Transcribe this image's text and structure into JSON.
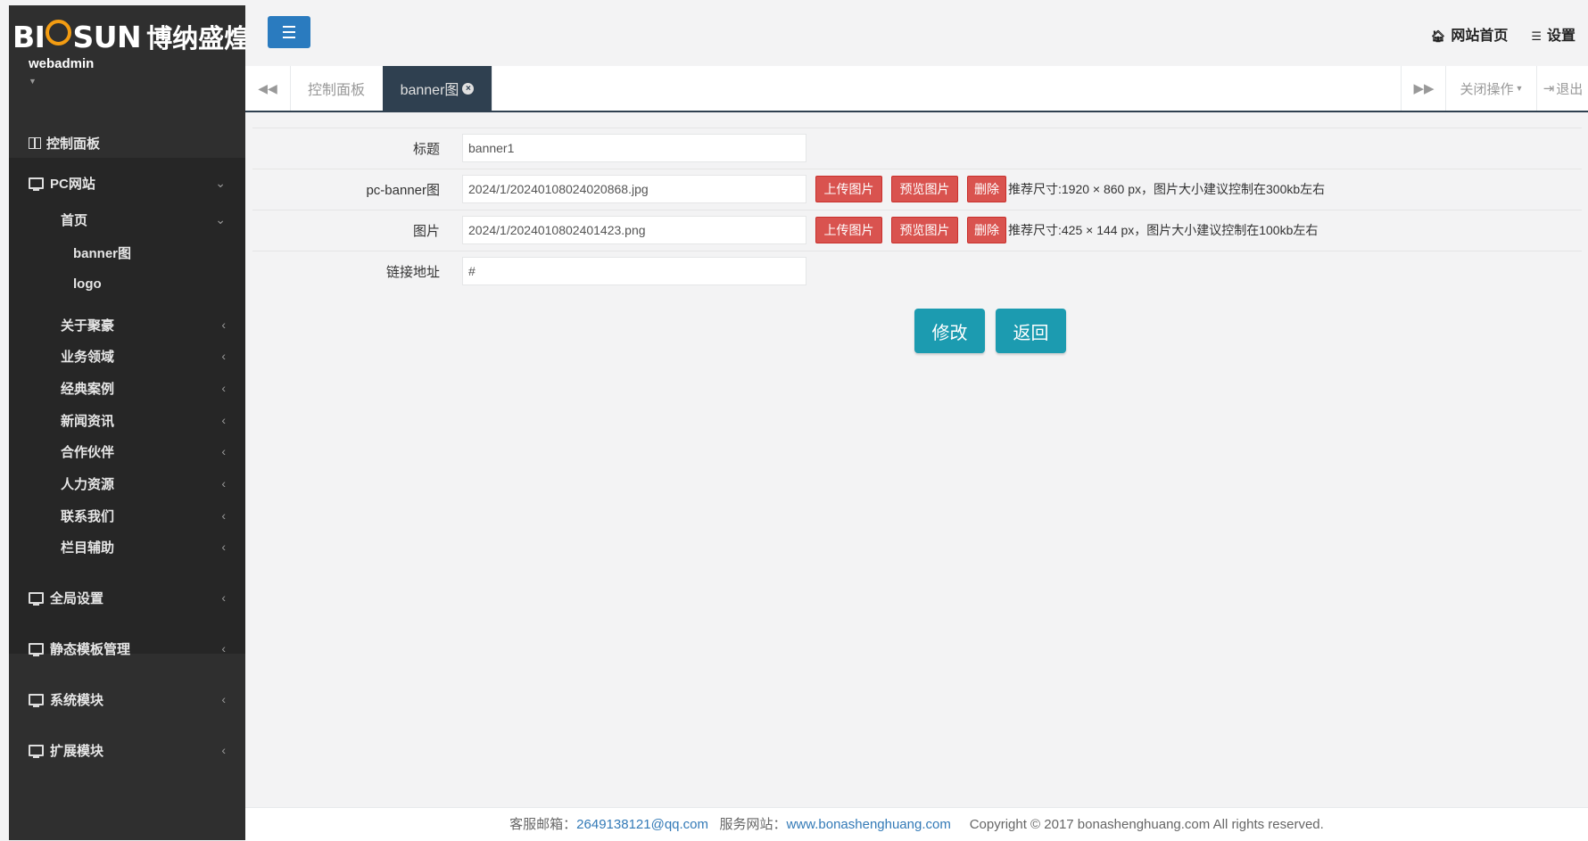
{
  "brand": {
    "logo_text_a": "BI",
    "logo_text_b": "SUN",
    "logo_cn": "博纳盛煌",
    "username": "webadmin",
    "accent": "#f39c12"
  },
  "navbar": {
    "home_label": "网站首页",
    "settings_label": "设置",
    "toggle_icon": "hamburger-icon"
  },
  "tabs": {
    "items": [
      {
        "label": "控制面板"
      },
      {
        "label": "banner图",
        "active": true
      }
    ],
    "close_ops_label": "关闭操作",
    "logout_label": "退出"
  },
  "sidebar": {
    "dashboard": "控制面板",
    "pc_site": "PC网站",
    "home": "首页",
    "home_children": [
      "banner图",
      "logo"
    ],
    "pc_sections": [
      "关于聚豪",
      "业务领域",
      "经典案例",
      "新闻资讯",
      "合作伙伴",
      "人力资源",
      "联系我们",
      "栏目辅助"
    ],
    "bottom": [
      "全局设置",
      "静态模板管理",
      "系统模块",
      "扩展模块"
    ]
  },
  "form": {
    "title_label": "标题",
    "title_value": "banner1",
    "pcbanner_label": "pc-banner图",
    "pcbanner_value": "2024/1/20240108024020868.jpg",
    "image_label": "图片",
    "image_value": "2024/1/2024010802401423.png",
    "link_label": "链接地址",
    "link_value": "#",
    "upload_label": "上传图片",
    "preview_label": "预览图片",
    "delete_label": "删除",
    "pcbanner_hint": "推荐尺寸:1920 × 860 px，图片大小建议控制在300kb左右",
    "image_hint": "推荐尺寸:425 × 144 px，图片大小建议控制在100kb左右",
    "submit_label": "修改",
    "back_label": "返回"
  },
  "footer": {
    "email_label": "客服邮箱：",
    "email": "2649138121@qq.com",
    "site_label": "服务网站：",
    "site": "www.bonashenghuang.com",
    "copyright": "Copyright © 2017 bonashenghuang.com All rights reserved."
  }
}
